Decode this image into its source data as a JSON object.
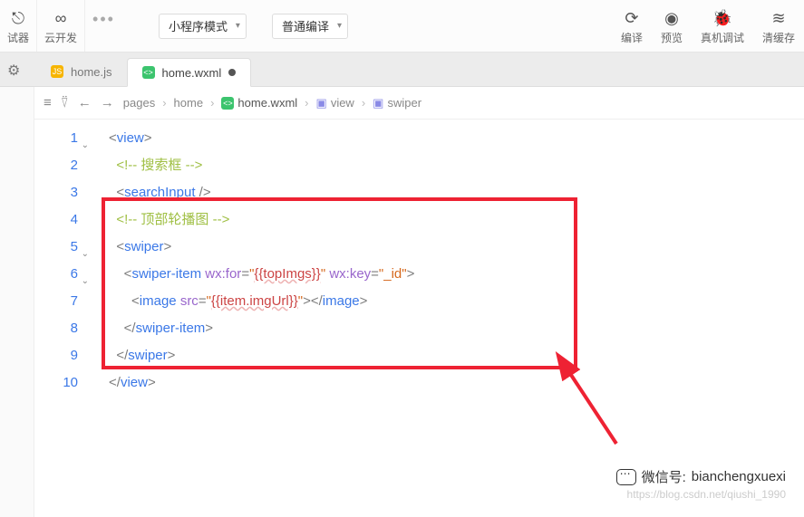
{
  "toolbar": {
    "debugger_label": "试器",
    "cloud_dev_label": "云开发",
    "mode_select": "小程序模式",
    "compile_select": "普通编译",
    "compile_label": "编译",
    "preview_label": "预览",
    "real_device_label": "真机调试",
    "clear_cache_label": "清缓存"
  },
  "tabs": [
    {
      "icon": "js",
      "icon_text": "JS",
      "label": "home.js",
      "active": false,
      "dirty": false
    },
    {
      "icon": "wxml",
      "icon_text": "<>",
      "label": "home.wxml",
      "active": true,
      "dirty": true
    }
  ],
  "breadcrumb": {
    "items": [
      "pages",
      "home",
      "home.wxml",
      "view",
      "swiper"
    ]
  },
  "code": {
    "lines": [
      {
        "n": 1,
        "fold": true,
        "segs": [
          [
            "angle",
            "<"
          ],
          [
            "tagn",
            "view"
          ],
          [
            "angle",
            ">"
          ]
        ]
      },
      {
        "n": 2,
        "fold": false,
        "indent": 2,
        "segs": [
          [
            "comment",
            "<!-- 搜索框 -->"
          ]
        ]
      },
      {
        "n": 3,
        "fold": false,
        "indent": 2,
        "segs": [
          [
            "angle",
            "<"
          ],
          [
            "tagn",
            "searchInput"
          ],
          [
            "angle",
            " />"
          ]
        ]
      },
      {
        "n": 4,
        "fold": false,
        "indent": 2,
        "segs": [
          [
            "comment",
            "<!-- 顶部轮播图 -->"
          ]
        ]
      },
      {
        "n": 5,
        "fold": true,
        "indent": 2,
        "segs": [
          [
            "angle",
            "<"
          ],
          [
            "tagn",
            "swiper"
          ],
          [
            "angle",
            ">"
          ]
        ]
      },
      {
        "n": 6,
        "fold": true,
        "indent": 4,
        "segs": [
          [
            "angle",
            "<"
          ],
          [
            "tagn",
            "swiper-item"
          ],
          [
            "plain",
            " "
          ],
          [
            "attr",
            "wx:for"
          ],
          [
            "angle",
            "="
          ],
          [
            "str",
            "\""
          ],
          [
            "expr",
            "{{topImgs}}"
          ],
          [
            "str",
            "\""
          ],
          [
            "plain",
            " "
          ],
          [
            "attr",
            "wx:key"
          ],
          [
            "angle",
            "="
          ],
          [
            "str",
            "\"_id\""
          ],
          [
            "angle",
            ">"
          ]
        ]
      },
      {
        "n": 7,
        "fold": false,
        "indent": 6,
        "segs": [
          [
            "angle",
            "<"
          ],
          [
            "tagn",
            "image"
          ],
          [
            "plain",
            " "
          ],
          [
            "attr",
            "src"
          ],
          [
            "angle",
            "="
          ],
          [
            "str",
            "\""
          ],
          [
            "expr",
            "{{item.imgUrl}}"
          ],
          [
            "str",
            "\""
          ],
          [
            "angle",
            "></"
          ],
          [
            "tagn",
            "image"
          ],
          [
            "angle",
            ">"
          ]
        ]
      },
      {
        "n": 8,
        "fold": false,
        "indent": 4,
        "segs": [
          [
            "angle",
            "</"
          ],
          [
            "tagn",
            "swiper-item"
          ],
          [
            "angle",
            ">"
          ]
        ]
      },
      {
        "n": 9,
        "fold": false,
        "indent": 2,
        "segs": [
          [
            "angle",
            "</"
          ],
          [
            "tagn",
            "swiper"
          ],
          [
            "angle",
            ">"
          ]
        ]
      },
      {
        "n": 10,
        "fold": false,
        "segs": [
          [
            "angle",
            "</"
          ],
          [
            "tagn",
            "view"
          ],
          [
            "angle",
            ">"
          ]
        ]
      }
    ]
  },
  "watermark": {
    "line1_label": "微信号:",
    "line1_value": "bianchengxuexi",
    "line2": "https://blog.csdn.net/qiushi_1990"
  }
}
